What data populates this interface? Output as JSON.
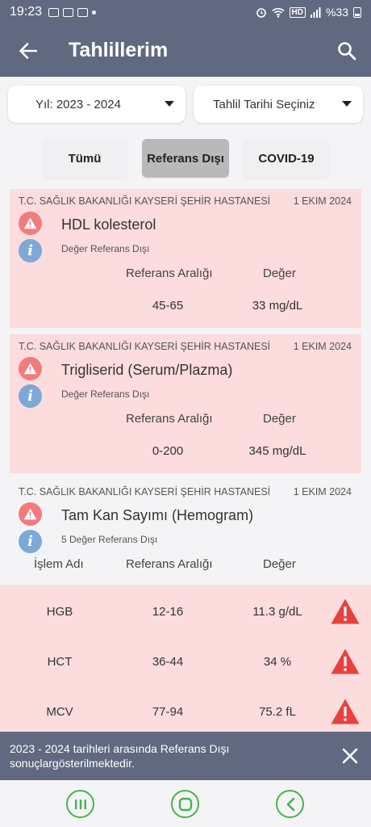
{
  "status_bar": {
    "time": "19:23",
    "battery": "%33"
  },
  "header": {
    "title": "Tahlillerim"
  },
  "filters": {
    "year": "Yıl: 2023 - 2024",
    "date": "Tahlil Tarihi Seçiniz"
  },
  "tabs": [
    {
      "label": "Tümü",
      "active": false
    },
    {
      "label": "Referans Dışı",
      "active": true
    },
    {
      "label": "COVID-19",
      "active": false
    }
  ],
  "cards": [
    {
      "hospital": "T.C. SAĞLIK BAKANLIĞI KAYSERİ ŞEHİR HASTANESİ",
      "date": "1 EKIM 2024",
      "test": "HDL kolesterol",
      "status": "Değer Referans Dışı",
      "ref_header": "Referans Aralığı",
      "value_header": "Değer",
      "ref": "45-65",
      "value": "33 mg/dL"
    },
    {
      "hospital": "T.C. SAĞLIK BAKANLIĞI KAYSERİ ŞEHİR HASTANESİ",
      "date": "1 EKIM 2024",
      "test": "Trigliserid (Serum/Plazma)",
      "status": "Değer Referans Dışı",
      "ref_header": "Referans Aralığı",
      "value_header": "Değer",
      "ref": "0-200",
      "value": "345 mg/dL"
    },
    {
      "hospital": "T.C. SAĞLIK BAKANLIĞI KAYSERİ ŞEHİR HASTANESİ",
      "date": "1 EKIM 2024",
      "test": "Tam Kan Sayımı (Hemogram)",
      "status": "5 Değer Referans Dışı",
      "name_header": "İşlem Adı",
      "ref_header": "Referans Aralığı",
      "value_header": "Değer"
    }
  ],
  "hemogram_rows": [
    {
      "name": "HGB",
      "ref": "12-16",
      "value": "11.3 g/dL"
    },
    {
      "name": "HCT",
      "ref": "36-44",
      "value": "34 %"
    },
    {
      "name": "MCV",
      "ref": "77-94",
      "value": "75.2 fL"
    }
  ],
  "snackbar": {
    "message": "2023 - 2024 tarihleri arasında Referans Dışı sonuçlargösterilmektedir."
  },
  "colors": {
    "header": "#616980",
    "alert_bg": "#fcdcdc",
    "warn_red": "#e8413d",
    "info_blue": "#7ca9d6",
    "nav_green": "#46b34d"
  }
}
